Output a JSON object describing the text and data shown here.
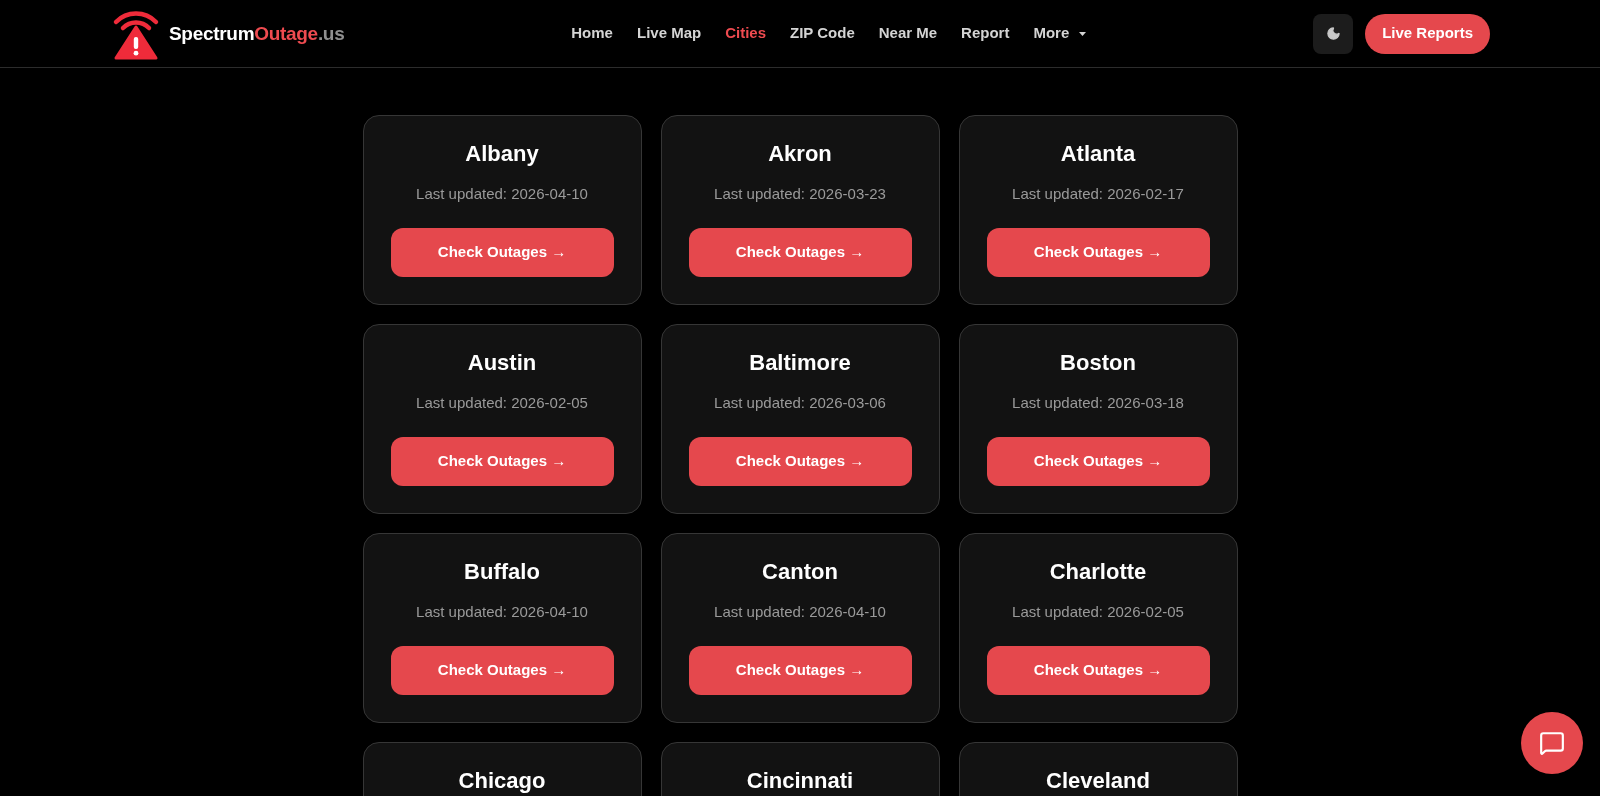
{
  "header": {
    "logo": {
      "part_1": "Spectrum",
      "part_2": "Outage",
      "part_3": ".us"
    },
    "nav": [
      {
        "label": "Home",
        "kind": "link",
        "selected": false
      },
      {
        "label": "Live Map",
        "kind": "link",
        "selected": false
      },
      {
        "label": "Cities",
        "kind": "link",
        "selected": true
      },
      {
        "label": "ZIP Code",
        "kind": "link",
        "selected": false
      },
      {
        "label": "Near Me",
        "kind": "link",
        "selected": false
      },
      {
        "label": "Report",
        "kind": "link",
        "selected": false
      },
      {
        "label": "More",
        "kind": "dropdown",
        "selected": false
      }
    ],
    "cta": "Live Reports"
  },
  "cities": [
    {
      "name": "Albany",
      "updated": "Last updated: 2026-04-10",
      "button": "Check Outages →"
    },
    {
      "name": "Akron",
      "updated": "Last updated: 2026-03-23",
      "button": "Check Outages →"
    },
    {
      "name": "Atlanta",
      "updated": "Last updated: 2026-02-17",
      "button": "Check Outages →"
    },
    {
      "name": "Austin",
      "updated": "Last updated: 2026-02-05",
      "button": "Check Outages →"
    },
    {
      "name": "Baltimore",
      "updated": "Last updated: 2026-03-06",
      "button": "Check Outages →"
    },
    {
      "name": "Boston",
      "updated": "Last updated: 2026-03-18",
      "button": "Check Outages →"
    },
    {
      "name": "Buffalo",
      "updated": "Last updated: 2026-04-10",
      "button": "Check Outages →"
    },
    {
      "name": "Canton",
      "updated": "Last updated: 2026-04-10",
      "button": "Check Outages →"
    },
    {
      "name": "Charlotte",
      "updated": "Last updated: 2026-02-05",
      "button": "Check Outages →"
    },
    {
      "name": "Chicago"
    },
    {
      "name": "Cincinnati"
    },
    {
      "name": "Cleveland"
    }
  ]
}
